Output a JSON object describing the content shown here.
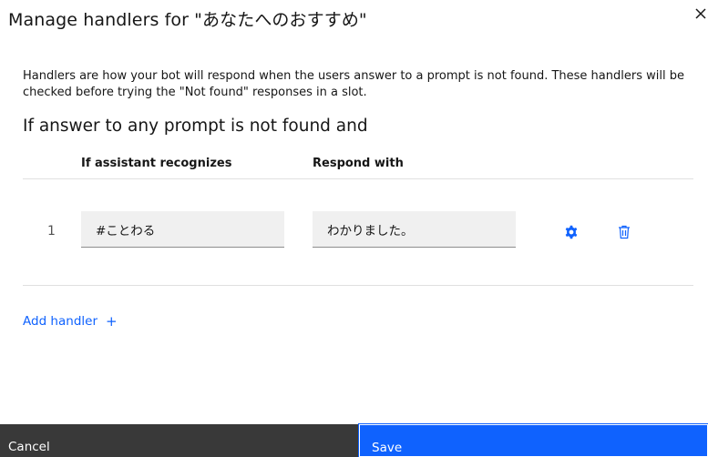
{
  "modal": {
    "title": "Manage handlers for \"あなたへのおすすめ\"",
    "close_icon": "close-icon"
  },
  "description": "Handlers are how your bot will respond when the users answer to a prompt is not found. These handlers will be checked before trying the \"Not found\" responses in a slot.",
  "subheading": "If answer to any prompt is not found and",
  "table": {
    "headers": {
      "recognizes": "If assistant recognizes",
      "respond": "Respond with"
    },
    "rows": [
      {
        "number": "1",
        "intent": "#ことわる",
        "response": "わかりました。",
        "settings_icon": "gear-icon",
        "delete_icon": "trash-icon"
      }
    ]
  },
  "add_handler": {
    "label": "Add handler",
    "icon": "+"
  },
  "footer": {
    "cancel_label": "Cancel",
    "save_label": "Save"
  },
  "colors": {
    "accent": "#0f62fe",
    "secondary_button": "#393939",
    "field_bg": "#f0f0f0"
  }
}
